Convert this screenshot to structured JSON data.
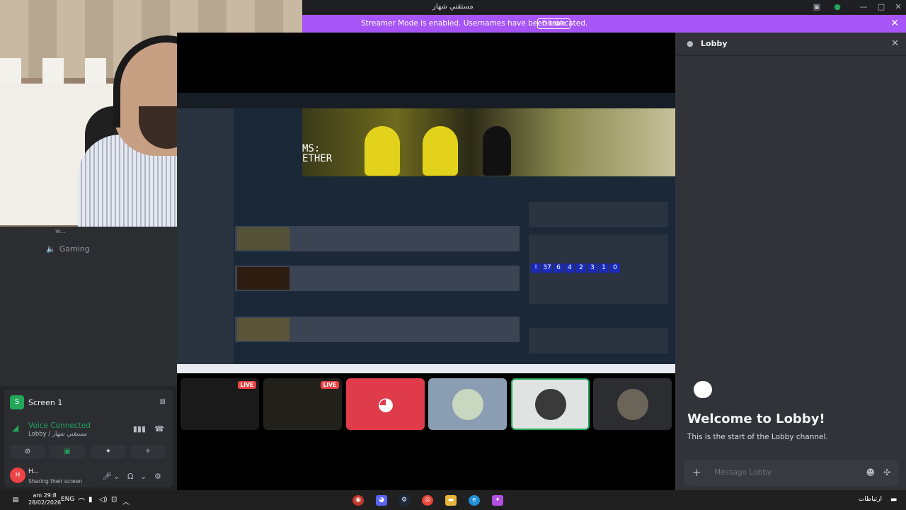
{
  "titlebar": {
    "title": "مستقني شهار"
  },
  "banner": {
    "message": "Streamer Mode is enabled. Usernames have been truncated.",
    "disable_label": "Disable",
    "color": "#a855f7"
  },
  "channels": {
    "preview_user": "w...",
    "voice_channel": "Gaming"
  },
  "stream": {
    "hero_title_1": "MS:",
    "hero_title_2": "ETHER",
    "counter_digits": [
      "!",
      "37",
      "6",
      "4",
      "2",
      "3",
      "1",
      "0"
    ]
  },
  "screen_card": {
    "title": "Screen 1",
    "voice_status": "Voice Connected",
    "voice_channel_path": "Lobby / مستقني شهار"
  },
  "user": {
    "name": "H...",
    "status": "Sharing their screen",
    "avatar_initial": "H"
  },
  "tiles": {
    "live_label": "LIVE"
  },
  "chat": {
    "channel_name": "Lobby",
    "welcome": "Welcome to Lobby!",
    "start_text": "This is the start of the Lobby channel.",
    "composer_placeholder": "Message Lobby"
  },
  "taskbar": {
    "time": "am 29:8",
    "date": "28/02/2026",
    "language": "ENG",
    "notifications": "ارتباطات"
  },
  "colors": {
    "accent_green": "#23a55a",
    "discord_red": "#ed4245",
    "background": "#1e1f22"
  },
  "icons": [
    "search-icon",
    "discord-icon",
    "steam-icon",
    "chrome-icon",
    "folder-icon",
    "edge-icon",
    "copilot-icon",
    "gear-icon",
    "microphone-icon",
    "headphones-icon",
    "close-icon",
    "speaker-icon"
  ]
}
